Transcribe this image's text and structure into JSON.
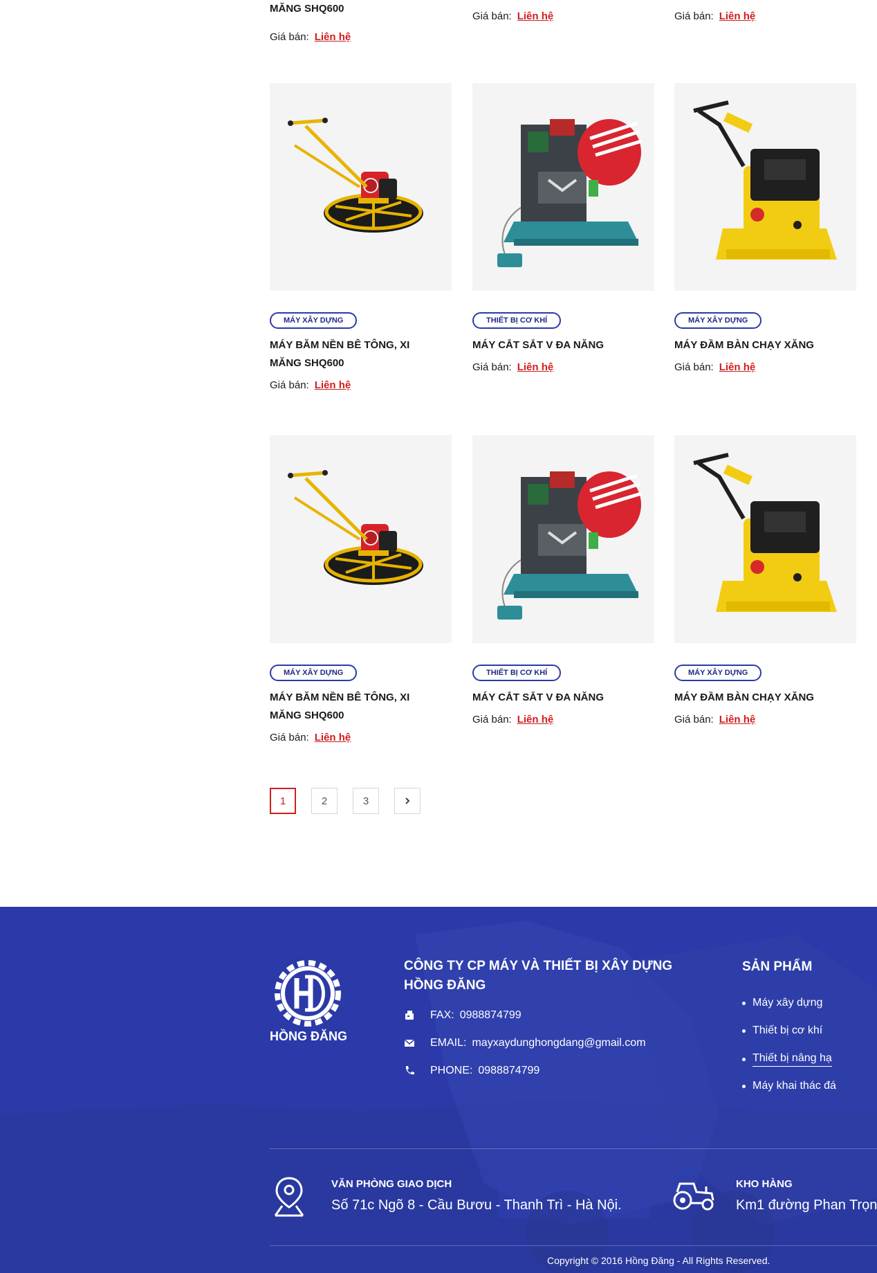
{
  "top_partial": {
    "name_line": "MĂNG SHQ600",
    "price_label": "Giá bán:",
    "price_value": "Liên hệ"
  },
  "products": [
    {
      "category": "MÁY XÂY DỰNG",
      "name": "MÁY BĂM NỀN BÊ TÔNG, XI MĂNG SHQ600",
      "price_label": "Giá bán:",
      "price_value": "Liên hệ",
      "image": "power-trowel"
    },
    {
      "category": "THIẾT BỊ CƠ KHÍ",
      "name": "MÁY CẮT SẮT V ĐA NĂNG",
      "price_label": "Giá bán:",
      "price_value": "Liên hệ",
      "image": "angle-cutter"
    },
    {
      "category": "MÁY XÂY DỰNG",
      "name": "MÁY ĐẦM BÀN CHẠY XĂNG",
      "price_label": "Giá bán:",
      "price_value": "Liên hệ",
      "image": "plate-compactor"
    },
    {
      "category": "MÁY XÂY DỰNG",
      "name": "MÁY BĂM NỀN BÊ TÔNG, XI MĂNG SHQ600",
      "price_label": "Giá bán:",
      "price_value": "Liên hệ",
      "image": "power-trowel"
    },
    {
      "category": "THIẾT BỊ CƠ KHÍ",
      "name": "MÁY CẮT SẮT V ĐA NĂNG",
      "price_label": "Giá bán:",
      "price_value": "Liên hệ",
      "image": "angle-cutter"
    },
    {
      "category": "MÁY XÂY DỰNG",
      "name": "MÁY ĐẦM BÀN CHẠY XĂNG",
      "price_label": "Giá bán:",
      "price_value": "Liên hệ",
      "image": "plate-compactor"
    }
  ],
  "pagination": {
    "pages": [
      "1",
      "2",
      "3"
    ],
    "active": "1",
    "next_icon": "chevron-right-icon"
  },
  "footer": {
    "logo_text": "HỒNG ĐĂNG",
    "company_line1": "CÔNG TY CP MÁY VÀ THIẾT BỊ XÂY DỰNG",
    "company_line2": "HỒNG ĐĂNG",
    "fax_label": "FAX:",
    "fax_value": "0988874799",
    "email_label": "EMAIL:",
    "email_value": "mayxaydunghongdang@gmail.com",
    "phone_label": "PHONE:",
    "phone_value": "0988874799",
    "products_title": "SẢN PHẨM",
    "product_links": [
      "Máy xây dựng",
      "Thiết bị cơ khí",
      "Thiết bị nâng hạ",
      "Máy khai thác đá"
    ],
    "office_title": "VĂN PHÒNG GIAO DỊCH",
    "office_address": "Số 71c Ngõ 8 - Cầu Bươu - Thanh Trì - Hà Nội.",
    "warehouse_title": "KHO HÀNG",
    "warehouse_address": "Km1 đường Phan Trọn",
    "copyright": "Copyright © 2016 Hồng Đăng - All Rights Reserved.",
    "background_color": "#2b3aa8"
  },
  "colors": {
    "accent_red": "#d21d1d",
    "brand_blue": "#2b3aa8",
    "tag_blue": "#1e2b86"
  }
}
